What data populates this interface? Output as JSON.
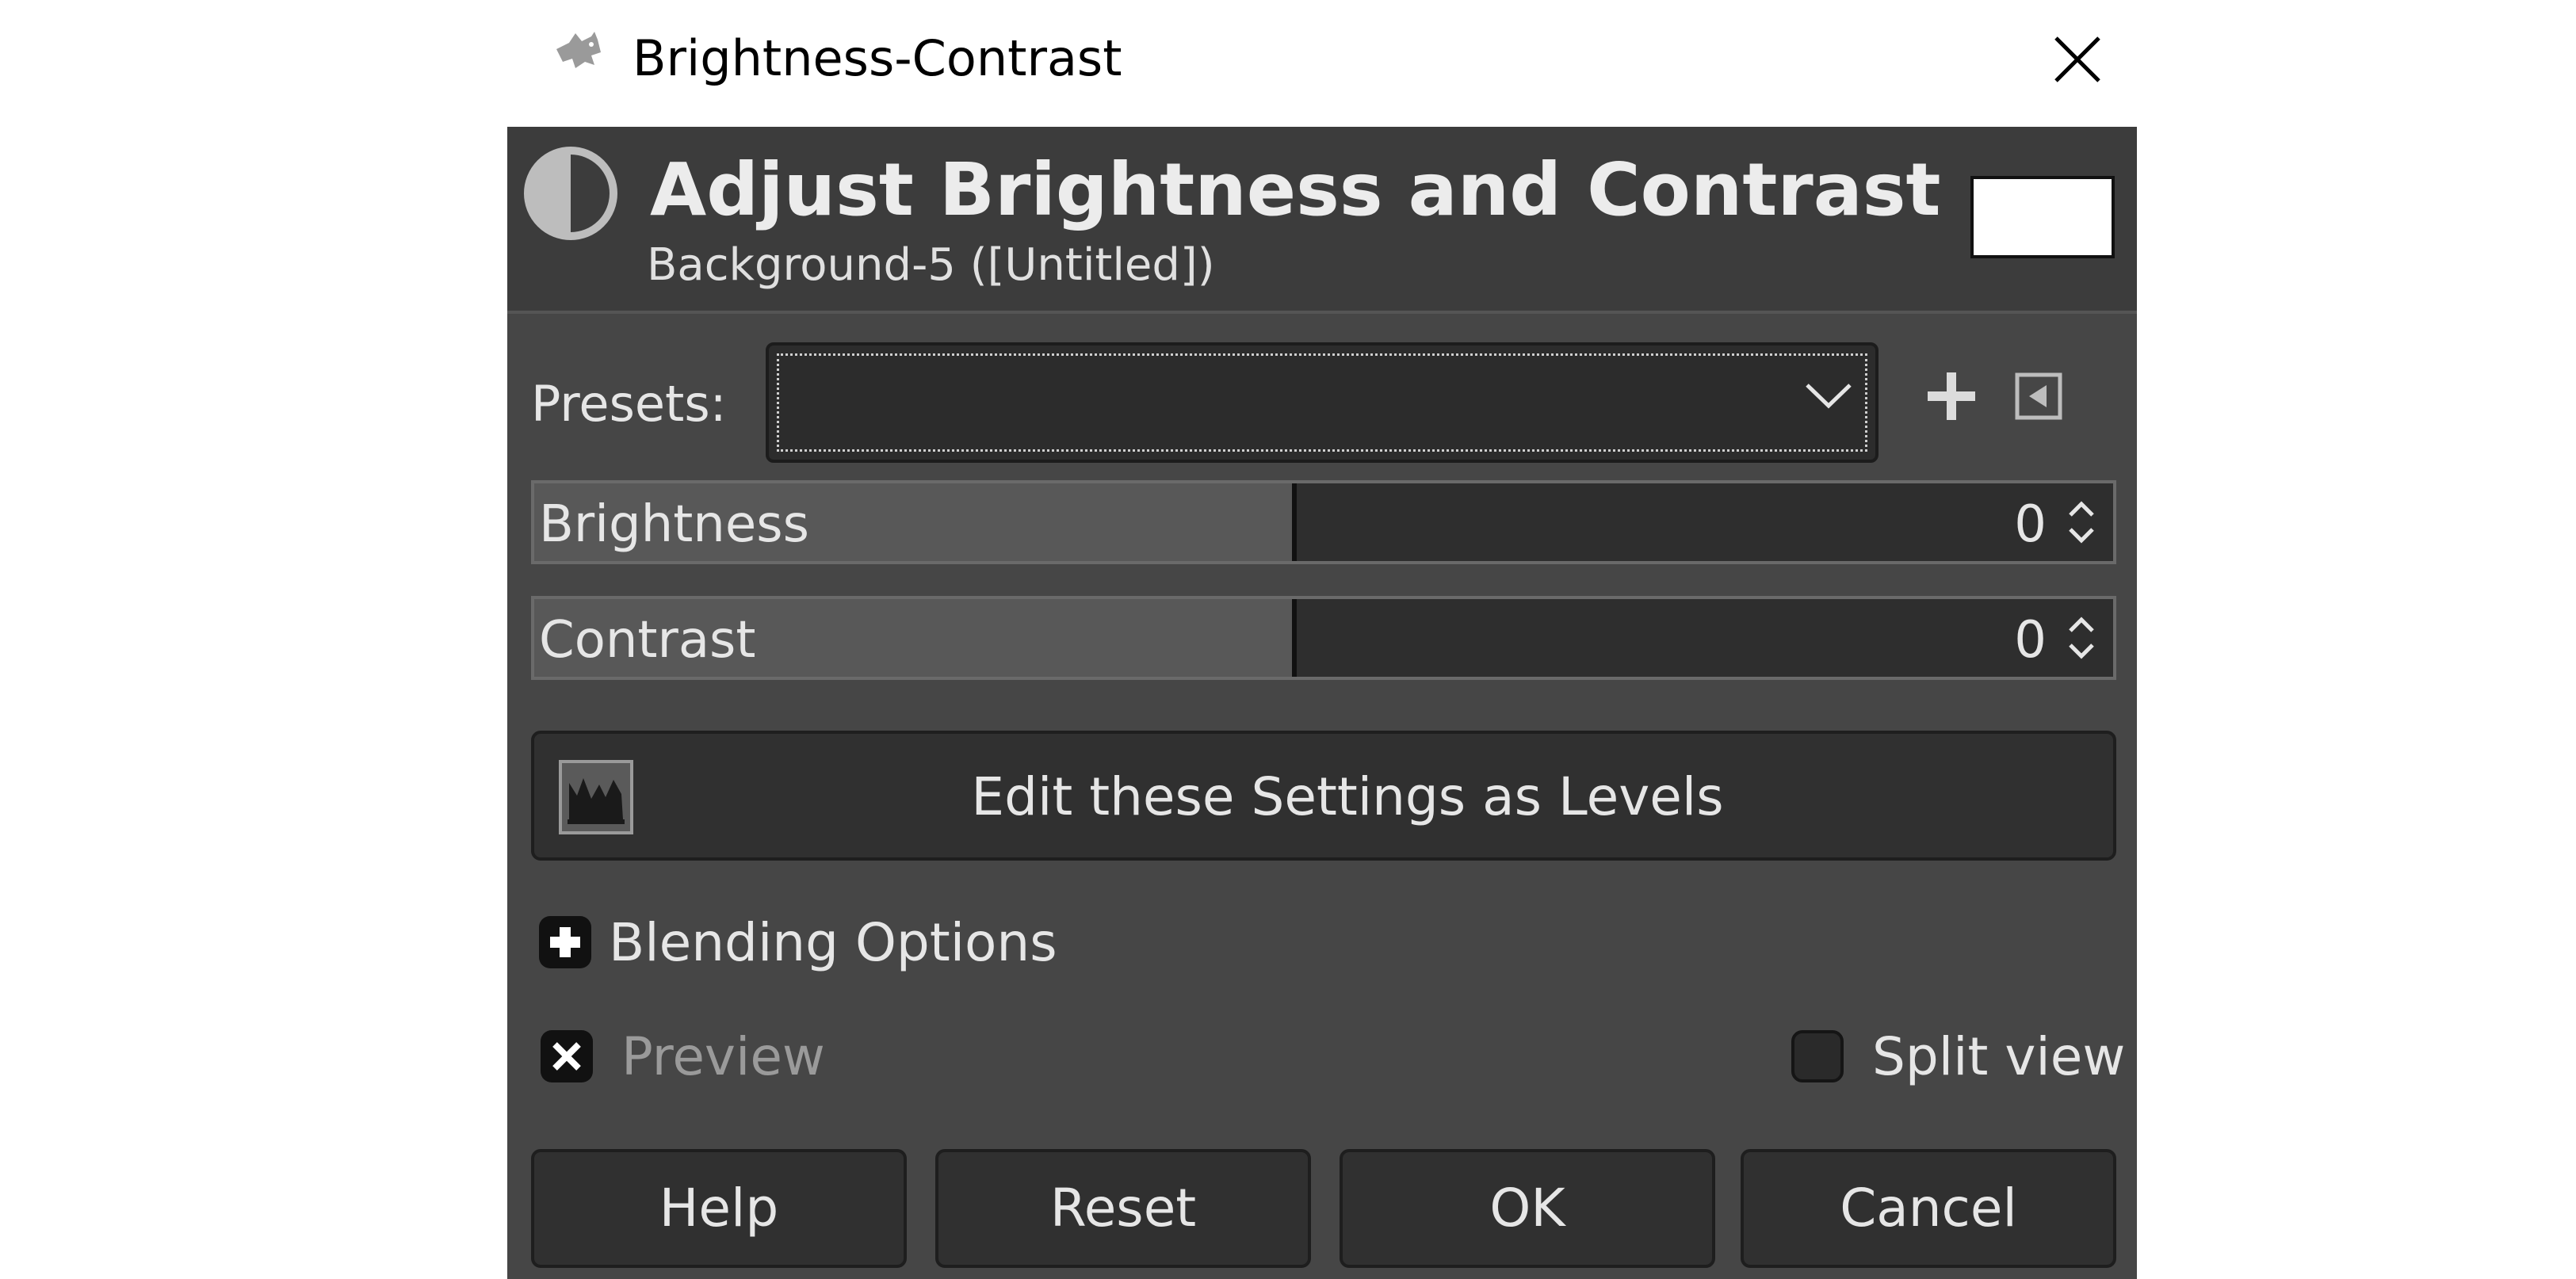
{
  "window": {
    "title": "Brightness-Contrast",
    "close_icon": "close-icon",
    "app_icon": "gimp-icon"
  },
  "header": {
    "title": "Adjust Brightness and Contrast",
    "subtitle": "Background-5 ([Untitled])",
    "icon": "brightness-contrast-icon"
  },
  "presets": {
    "label": "Presets:",
    "value": ""
  },
  "sliders": [
    {
      "label": "Brightness",
      "value": "0",
      "fill_fraction": 0.48
    },
    {
      "label": "Contrast",
      "value": "0",
      "fill_fraction": 0.48
    }
  ],
  "levels_button": {
    "label": "Edit these Settings as Levels"
  },
  "blending": {
    "label": "Blending Options"
  },
  "preview": {
    "label": "Preview",
    "checked": true
  },
  "split_view": {
    "label": "Split view",
    "checked": false
  },
  "buttons": {
    "help": "Help",
    "reset": "Reset",
    "ok": "OK",
    "cancel": "Cancel"
  }
}
